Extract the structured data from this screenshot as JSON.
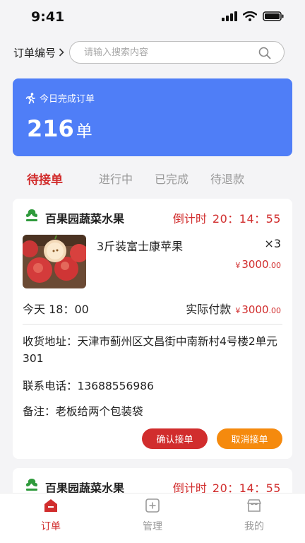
{
  "status_bar": {
    "time": "9:41"
  },
  "search": {
    "filter_label": "订单编号",
    "placeholder": "请输入搜索内容"
  },
  "today": {
    "label": "今日完成订单",
    "count": "216",
    "unit": "单"
  },
  "tabs": [
    {
      "label": "待接单",
      "active": true
    },
    {
      "label": "进行中",
      "active": false
    },
    {
      "label": "已完成",
      "active": false
    },
    {
      "label": "待退款",
      "active": false
    }
  ],
  "orders": [
    {
      "shop_name": "百果园蔬菜水果",
      "countdown_label": "倒计时",
      "countdown_time": "20：14：55",
      "product_name": "3斤装富士康苹果",
      "quantity": "×3",
      "currency": "¥",
      "price_int": "3000",
      "price_dec": ".00",
      "delivery_time": "今天 18：00",
      "actual_pay_label": "实际付款",
      "actual_pay_int": "3000",
      "actual_pay_dec": ".00",
      "address": "收货地址：天津市蓟州区文昌街中南新村4号楼2单元301",
      "phone": "联系电话：13688556986",
      "remark": "备注：老板给两个包装袋",
      "confirm_label": "确认接单",
      "cancel_label": "取消接单"
    },
    {
      "shop_name": "百果园蔬菜水果",
      "countdown_label": "倒计时",
      "countdown_time": "20：14：55"
    }
  ],
  "tabbar": [
    {
      "label": "订单",
      "icon": "order-icon",
      "active": true
    },
    {
      "label": "管理",
      "icon": "manage-icon",
      "active": false
    },
    {
      "label": "我的",
      "icon": "profile-icon",
      "active": false
    }
  ],
  "colors": {
    "primary_red": "#d12d2d",
    "card_blue": "#4f7ef7",
    "cancel_orange": "#f58a0e"
  }
}
